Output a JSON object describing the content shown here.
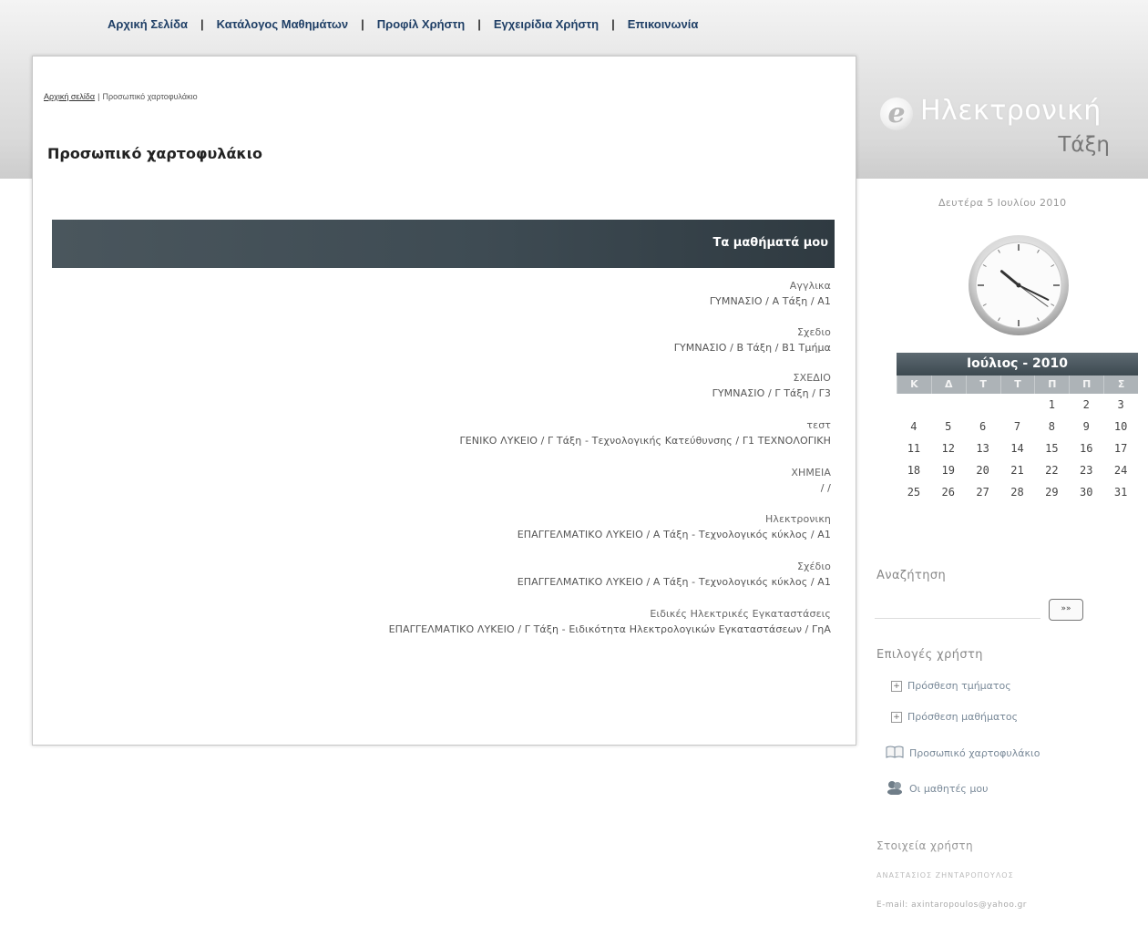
{
  "nav": {
    "items": [
      "Αρχική Σελίδα",
      "Κατάλογος Μαθημάτων",
      "Προφίλ Χρήστη",
      "Εγχειρίδια Χρήστη",
      "Επικοινωνία"
    ],
    "separator": "|"
  },
  "breadcrumb": {
    "home": "Αρχική σελίδα",
    "separator": "|",
    "current": "Προσωπικό χαρτοφυλάκιο"
  },
  "page": {
    "title": "Προσωπικό χαρτοφυλάκιο",
    "courses_header": "Τα μαθήματά μου"
  },
  "courses": [
    {
      "name": "Αγγλικα",
      "path": "ΓΥΜΝΑΣΙΟ / Α Τάξη / Α1"
    },
    {
      "name": "Σχεδιο",
      "path": "ΓΥΜΝΑΣΙΟ / Β Τάξη / Β1 Τμήμα"
    },
    {
      "name": "ΣΧΕΔΙΟ",
      "path": "ΓΥΜΝΑΣΙΟ / Γ Τάξη / Γ3"
    },
    {
      "name": "τεστ",
      "path": "ΓΕΝΙΚΟ ΛΥΚΕΙΟ / Γ Τάξη - Τεχνολογικής Κατεύθυνσης / Γ1 ΤΕΧΝΟΛΟΓΙΚΗ"
    },
    {
      "name": "ΧΗΜΕΙΑ",
      "path": "/ /"
    },
    {
      "name": "Ηλεκτρονικη",
      "path": "ΕΠΑΓΓΕΛΜΑΤΙΚΟ ΛΥΚΕΙΟ / Α Τάξη - Τεχνολογικός κύκλος / Α1"
    },
    {
      "name": "Σχέδιο",
      "path": "ΕΠΑΓΓΕΛΜΑΤΙΚΟ ΛΥΚΕΙΟ / Α Τάξη - Τεχνολογικός κύκλος / Α1"
    },
    {
      "name": "Ειδικές Ηλεκτρικές Εγκαταστάσεις",
      "path": "ΕΠΑΓΓΕΛΜΑΤΙΚΟ ΛΥΚΕΙΟ / Γ Τάξη - Ειδικότητα Ηλεκτρολογικών Εγκαταστάσεων / ΓηΑ"
    }
  ],
  "logo": {
    "mark": "e",
    "line1": "Ηλεκτρονική",
    "line2": "Τάξη"
  },
  "date": "Δευτέρα 5 Ιουλίου 2010",
  "clock": {
    "hour": 10,
    "minute": 19,
    "second": 21
  },
  "calendar": {
    "title": "Ιούλιος - 2010",
    "weekdays": [
      "Κ",
      "Δ",
      "Τ",
      "Τ",
      "Π",
      "Π",
      "Σ"
    ],
    "first_weekday_index": 4,
    "days_in_month": 31
  },
  "search": {
    "label": "Αναζήτηση",
    "value": "",
    "button": "»»"
  },
  "options": {
    "label": "Επιλογές χρήστη",
    "items": [
      "Πρόσθεση τμήματος",
      "Πρόσθεση μαθήματος",
      "Προσωπικό χαρτοφυλάκιο",
      "Οι μαθητές μου"
    ]
  },
  "user": {
    "label": "Στοιχεία χρήστη",
    "name": "ΑΝΑΣΤΑΣΙΟΣ ΖΗΝΤΑΡΟΠΟΥΛΟΣ",
    "email": "E-mail: axintaropoulos@yahoo.gr"
  },
  "colors": {
    "nav_text": "#1f3f66",
    "bar": "#3e4b53",
    "calendar_head": "#4a565d"
  }
}
